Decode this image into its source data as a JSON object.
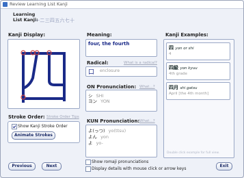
{
  "window_title": "Review Learning List Kanji",
  "list_label_line1": "Learning",
  "list_label_line2": "List Kanji:",
  "list_kanji": "一二三四五六七十",
  "kanji_display_label": "Kanji Display:",
  "kanji_char": "四",
  "stroke_order_label": "Stroke Order:",
  "stroke_order_tips": "Stroke Order Tips",
  "show_stroke_order": "Show Kanji Stroke Order",
  "animate_strokes": "Animate Strokes",
  "meaning_label": "Meaning:",
  "meaning_value": "four, the fourth",
  "radical_label": "Radical:",
  "radical_link": "What is a radical?",
  "radical_char": "口",
  "radical_name": "enclosure",
  "on_label": "ON Pronunciation:",
  "on_link": "What...?",
  "on_items": [
    {
      "kana": "シ",
      "romaji": "SHI"
    },
    {
      "kana": "ヨン",
      "romaji": "YON"
    }
  ],
  "kun_label": "KUN Pronunciation:",
  "kun_link": "What...?",
  "kun_items": [
    {
      "kana": "よ(っつ)",
      "romaji": "yo(ttsu)"
    },
    {
      "kana": "よん",
      "romaji": "yon"
    },
    {
      "kana": "よ",
      "romaji": "yo-"
    }
  ],
  "examples_label": "Kanji Examples:",
  "examples": [
    {
      "word": "四",
      "reading": "yon or shi",
      "meaning": "4"
    },
    {
      "word": "四級",
      "reading": "yon kyuu",
      "meaning": "4th grade"
    },
    {
      "word": "四月",
      "reading": "shi gatsu",
      "meaning": "April [the 4th month]"
    }
  ],
  "examples_hint": "Double click example for full view.",
  "show_romaji": "Show romaji pronunciations",
  "display_details": "Display details with mouse click or arrow keys",
  "previous_label": "Previous",
  "next_label": "Next",
  "exit_label": "Exit",
  "accent_color": "#1a2a88",
  "stroke_dot_color": "#c84040"
}
